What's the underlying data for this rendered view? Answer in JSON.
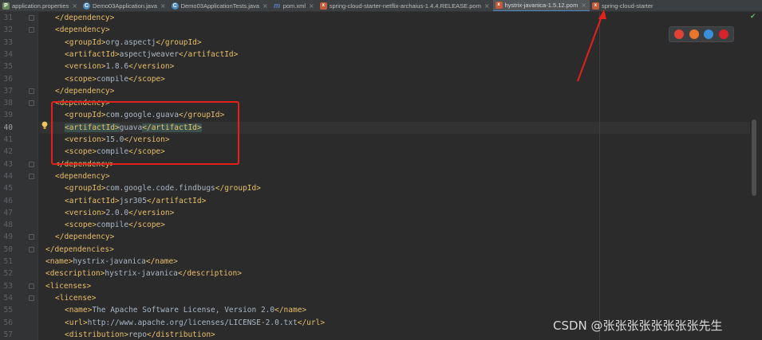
{
  "tabs": [
    {
      "label": "application.properties",
      "icon": "properties-file-icon",
      "active": false
    },
    {
      "label": "Demo03Application.java",
      "icon": "java-class-icon",
      "active": false
    },
    {
      "label": "Demo03ApplicationTests.java",
      "icon": "java-class-icon",
      "active": false
    },
    {
      "label": "pom.xml",
      "icon": "maven-icon",
      "active": false
    },
    {
      "label": "spring-cloud-starter-netflix-archaius-1.4.4.RELEASE.pom",
      "icon": "pom-file-icon",
      "active": false
    },
    {
      "label": "hystrix-javanica-1.5.12.pom",
      "icon": "pom-file-icon",
      "active": true
    },
    {
      "label": "spring-cloud-starter",
      "icon": "pom-file-icon",
      "active": false
    }
  ],
  "tab_close_glyph": "×",
  "current_line": 40,
  "lines": [
    {
      "n": "31",
      "indent": 1,
      "code": "</dependency>"
    },
    {
      "n": "32",
      "indent": 1,
      "code": "<dependency>"
    },
    {
      "n": "33",
      "indent": 2,
      "code": "<groupId>org.aspectj</groupId>"
    },
    {
      "n": "34",
      "indent": 2,
      "code": "<artifactId>aspectjweaver</artifactId>"
    },
    {
      "n": "35",
      "indent": 2,
      "code": "<version>1.8.6</version>"
    },
    {
      "n": "36",
      "indent": 2,
      "code": "<scope>compile</scope>"
    },
    {
      "n": "37",
      "indent": 1,
      "code": "</dependency>"
    },
    {
      "n": "38",
      "indent": 1,
      "code": "<dependency>"
    },
    {
      "n": "39",
      "indent": 2,
      "code": "<groupId>com.google.guava</groupId>"
    },
    {
      "n": "40",
      "indent": 2,
      "code": "<artifactId>guava</artifactId>"
    },
    {
      "n": "41",
      "indent": 2,
      "code": "<version>15.0</version>"
    },
    {
      "n": "42",
      "indent": 2,
      "code": "<scope>compile</scope>"
    },
    {
      "n": "43",
      "indent": 1,
      "code": "</dependency>"
    },
    {
      "n": "44",
      "indent": 1,
      "code": "<dependency>"
    },
    {
      "n": "45",
      "indent": 2,
      "code": "<groupId>com.google.code.findbugs</groupId>"
    },
    {
      "n": "46",
      "indent": 2,
      "code": "<artifactId>jsr305</artifactId>"
    },
    {
      "n": "47",
      "indent": 2,
      "code": "<version>2.0.0</version>"
    },
    {
      "n": "48",
      "indent": 2,
      "code": "<scope>compile</scope>"
    },
    {
      "n": "49",
      "indent": 1,
      "code": "</dependency>"
    },
    {
      "n": "50",
      "indent": 0,
      "code": "</dependencies>"
    },
    {
      "n": "51",
      "indent": 0,
      "code": "<name>hystrix-javanica</name>"
    },
    {
      "n": "52",
      "indent": 0,
      "code": "<description>hystrix-javanica</description>"
    },
    {
      "n": "53",
      "indent": 0,
      "code": "<licenses>"
    },
    {
      "n": "54",
      "indent": 1,
      "code": "<license>"
    },
    {
      "n": "55",
      "indent": 2,
      "code": "<name>The Apache Software License, Version 2.0</name>"
    },
    {
      "n": "56",
      "indent": 2,
      "code": "<url>http://www.apache.org/licenses/LICENSE-2.0.txt</url>"
    },
    {
      "n": "57",
      "indent": 2,
      "code": "<distribution>repo</distribution>"
    }
  ],
  "fold_lines": [
    "31",
    "32",
    "37",
    "38",
    "43",
    "44",
    "49",
    "50",
    "53",
    "54"
  ],
  "browsers": [
    {
      "name": "chrome-icon",
      "color": "#e34133"
    },
    {
      "name": "firefox-icon",
      "color": "#e8762d"
    },
    {
      "name": "safari-icon",
      "color": "#3b8ed8"
    },
    {
      "name": "opera-icon",
      "color": "#d6252a"
    }
  ],
  "annotation_color": "#e2211d",
  "watermark": "CSDN @张张张张张张张张先生"
}
